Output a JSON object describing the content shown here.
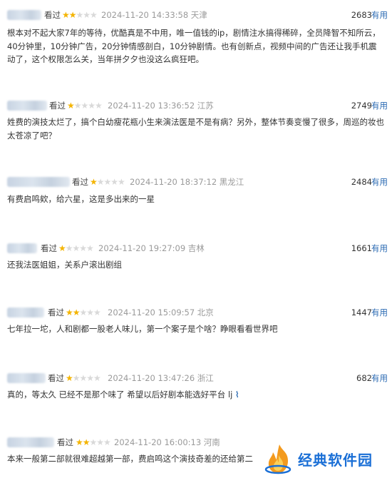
{
  "reviews": [
    {
      "watched": "看过",
      "stars": 2,
      "time": "2024-11-20 14:33:58 天津",
      "votes": "2683",
      "useful": "有用",
      "content": "根本对不起大家7年的等待，优酷真是不中用，唯一值钱的ip，剧情注水搞得稀碎，全员降智不知所云，40分钟里，10分钟广告，20分钟情感剖白，10分钟剧情。也有创新点，视频中间的广告还让我手机震动了，这个权限怎么关，当年拼夕夕也没这么疯狂吧。"
    },
    {
      "watched": "看过",
      "stars": 1,
      "time": "2024-11-20 13:36:52 江苏",
      "votes": "2749",
      "useful": "有用",
      "content": "姓费的演技太烂了，搞个白幼瘦花瓶小生来演法医是不是有病？另外，整体节奏变慢了很多，周巡的妆也太苍凉了吧？"
    },
    {
      "watched": "看过",
      "stars": 1,
      "time": "2024-11-20 18:37:12 黑龙江",
      "votes": "2484",
      "useful": "有用",
      "content": "有费启鸣欸，给六星，这是多出来的一星"
    },
    {
      "watched": "看过",
      "stars": 1,
      "time": "2024-11-20 19:27:09 吉林",
      "votes": "1661",
      "useful": "有用",
      "content": "还我法医姐姐，关系户滚出剧组"
    },
    {
      "watched": "看过",
      "stars": 2,
      "time": "2024-11-20 15:09:57 北京",
      "votes": "1447",
      "useful": "有用",
      "content": "七年拉一坨，人和剧都一股老人味儿，第一个案子是个啥？睁眼看看世界吧"
    },
    {
      "watched": "看过",
      "stars": 1,
      "time": "2024-11-20 13:47:26 浙江",
      "votes": "682",
      "useful": "有用",
      "content": "真的，等太久 已经不是那个味了 希望以后好剧本能选好平台 lj"
    },
    {
      "watched": "看过",
      "stars": 2,
      "time": "2024-11-20 16:00:13 河南",
      "votes": "",
      "useful": "",
      "content": "本来一般第二部就很难超越第一部，费启鸣这个演技奇差的还给第二"
    }
  ],
  "watermark": {
    "text": "经典软件园",
    "color": "#1a6fd6",
    "flame_color": "#f39a1e"
  },
  "colors": {
    "star_on": "#f4b400",
    "star_off": "#d9d9d9",
    "link": "#2c6bb3",
    "meta_gray": "#9a9a9a"
  }
}
